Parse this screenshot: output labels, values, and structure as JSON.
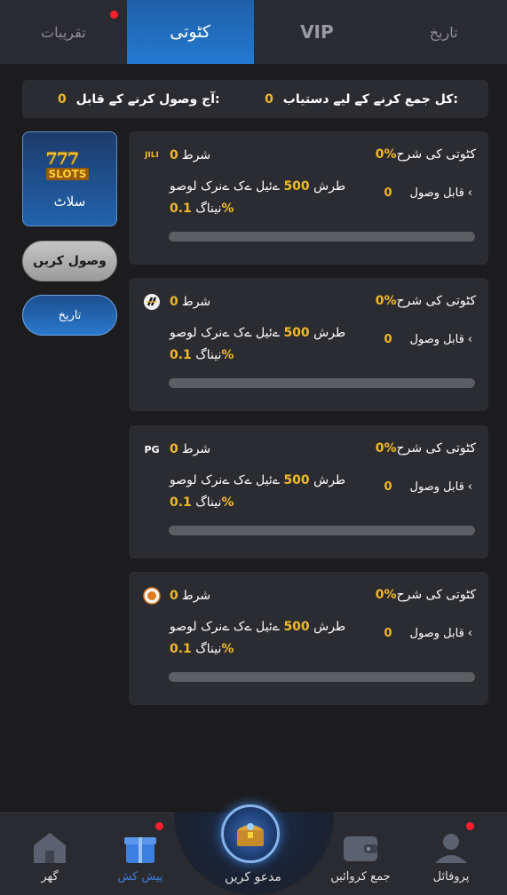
{
  "tabs": [
    {
      "label": "تقریبات",
      "has_dot": true
    },
    {
      "label": "کٹوتی",
      "active": true
    },
    {
      "label": "VIP"
    },
    {
      "label": "تاریخ"
    }
  ],
  "summary": {
    "total_label": "کل جمع کرنے کے لیے دستیاب:",
    "total_value": "0",
    "today_label": "آج وصول کرنے کے قابل:",
    "today_value": "0"
  },
  "sidebar": {
    "category_label": "سلاٹ",
    "logo_number": "777",
    "logo_word": "SLOTS",
    "collect_label": "وصول کریں",
    "history_label": "تاریخ"
  },
  "cards": [
    {
      "brand": "JILI",
      "condition_label": "شرط",
      "condition_value": "0",
      "rate_label": "کٹوتی کی شرح",
      "rate_value": "0%",
      "desc_prefix": "طرش",
      "desc_amount": "500",
      "desc_mid": "ےئیل ےک ےنرک لوصو",
      "desc_suffix": "نیناگ",
      "desc_pct": "0.1%",
      "available_label": "قابل وصول",
      "available_value": "0",
      "progress": 0
    },
    {
      "brand": "FC",
      "condition_label": "شرط",
      "condition_value": "0",
      "rate_label": "کٹوتی کی شرح",
      "rate_value": "0%",
      "desc_prefix": "طرش",
      "desc_amount": "500",
      "desc_mid": "ےئیل ےک ےنرک لوصو",
      "desc_suffix": "نیناگ",
      "desc_pct": "0.1%",
      "available_label": "قابل وصول",
      "available_value": "0",
      "progress": 0
    },
    {
      "brand": "PG",
      "condition_label": "شرط",
      "condition_value": "0",
      "rate_label": "کٹوتی کی شرح",
      "rate_value": "0%",
      "desc_prefix": "طرش",
      "desc_amount": "500",
      "desc_mid": "ےئیل ےک ےنرک لوصو",
      "desc_suffix": "نیناگ",
      "desc_pct": "0.1%",
      "available_label": "قابل وصول",
      "available_value": "0",
      "progress": 0
    },
    {
      "brand": "PLAY",
      "condition_label": "شرط",
      "condition_value": "0",
      "rate_label": "کٹوتی کی شرح",
      "rate_value": "0%",
      "desc_prefix": "طرش",
      "desc_amount": "500",
      "desc_mid": "ےئیل ےک ےنرک لوصو",
      "desc_suffix": "نیناگ",
      "desc_pct": "0.1%",
      "available_label": "قابل وصول",
      "available_value": "0",
      "progress": 0
    }
  ],
  "bottom_nav": {
    "home": "گھر",
    "offers": "پیش کش",
    "invite": "مدعو کریں",
    "deposit": "جمع کروائیں",
    "profile": "پروفائل"
  },
  "colors": {
    "accent": "#2379d0",
    "highlight": "#f2b928",
    "badge": "#ff1f2e"
  }
}
